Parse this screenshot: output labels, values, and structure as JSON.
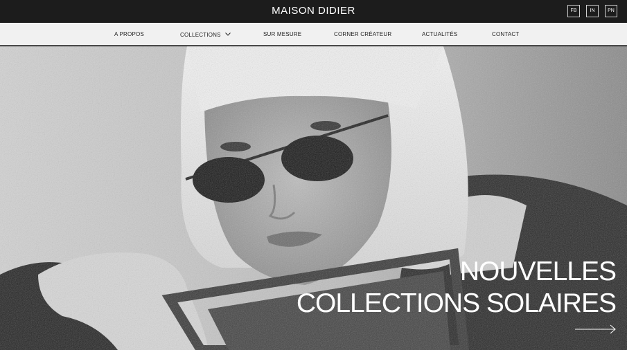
{
  "header": {
    "brand": "MAISON DIDIER",
    "socials": [
      {
        "label": "FB",
        "icon": "facebook-icon"
      },
      {
        "label": "IN",
        "icon": "instagram-icon"
      },
      {
        "label": "PN",
        "icon": "pinterest-icon"
      }
    ]
  },
  "nav": {
    "items": [
      {
        "label": "A PROPOS"
      },
      {
        "label": "COLLECTIONS",
        "has_dropdown": true
      },
      {
        "label": "SUR MESURE"
      },
      {
        "label": "CORNER CRÉATEUR"
      },
      {
        "label": "ACTUALITÉS"
      },
      {
        "label": "CONTACT"
      }
    ]
  },
  "hero": {
    "headline_line1": "NOUVELLES",
    "headline_line2": "COLLECTIONS SOLAIRES",
    "arrow_icon": "arrow-right-icon"
  },
  "colors": {
    "topbar": "#1c1c1c",
    "navbar": "#f1f1f1",
    "text_light": "#ffffff"
  }
}
